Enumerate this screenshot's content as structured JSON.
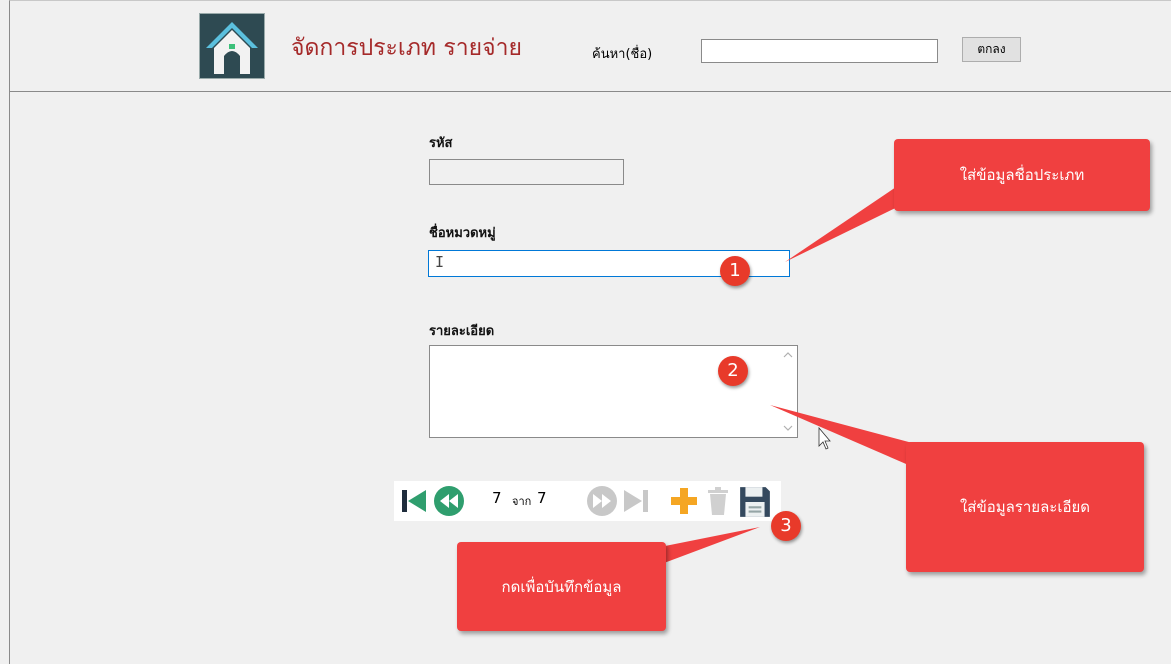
{
  "header": {
    "title": "จัดการประเภท รายจ่าย",
    "search_label": "ค้นหา(ชื่อ)",
    "search_value": "",
    "ok_button": "ตกลง"
  },
  "form": {
    "code_label": "รหัส",
    "code_value": "",
    "name_label": "ชื่อหมวดหมู่",
    "name_value": "I",
    "detail_label": "รายละเอียด",
    "detail_value": ""
  },
  "navigator": {
    "current": "7",
    "of_label": "จาก",
    "total": "7"
  },
  "callouts": {
    "c1": "ใส่ข้อมูลชื่อประเภท",
    "c2": "ใส่ข้อมูลรายละเอียด",
    "c3": "กดเพื่อบันทึกข้อมูล"
  },
  "badges": {
    "b1": "1",
    "b2": "2",
    "b3": "3"
  },
  "colors": {
    "callout": "#f04040",
    "title": "#a52a2a",
    "nav_green": "#2f9e6e",
    "add_orange": "#f5a623",
    "save_dark": "#34495e"
  }
}
